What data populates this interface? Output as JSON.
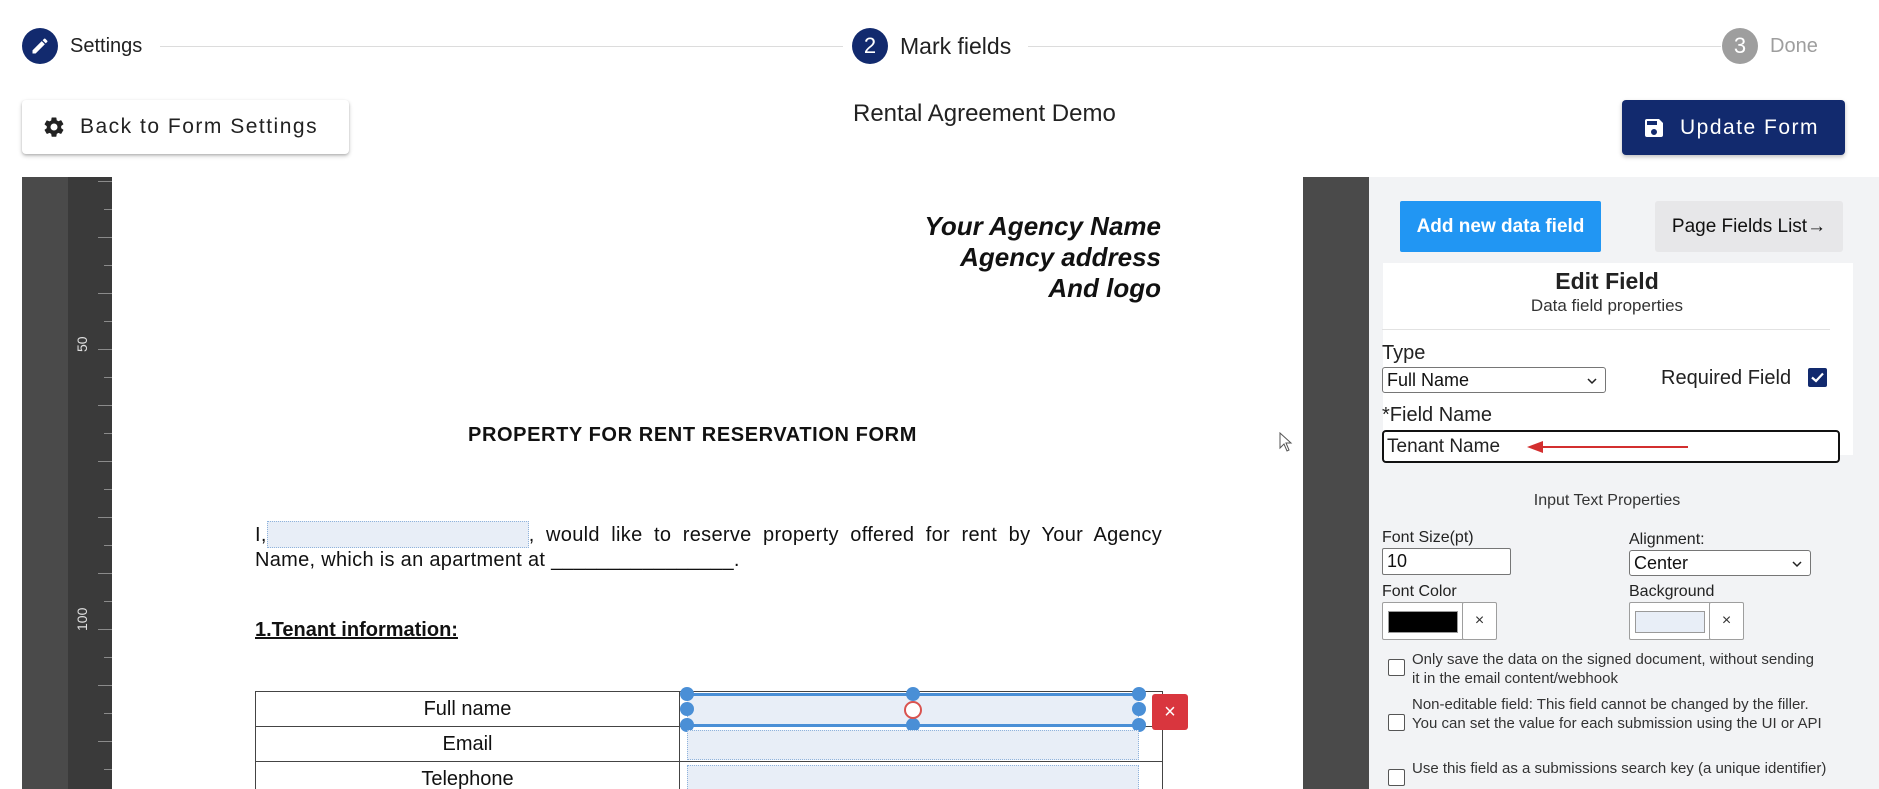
{
  "stepper": {
    "steps": [
      {
        "number": "",
        "label": "Settings",
        "state": "complete"
      },
      {
        "number": "2",
        "label": "Mark fields",
        "state": "active"
      },
      {
        "number": "3",
        "label": "Done",
        "state": "pending"
      }
    ]
  },
  "toolbar": {
    "back_label": "Back to Form Settings",
    "form_title": "Rental Agreement Demo",
    "update_label": "Update Form"
  },
  "ruler": {
    "marks": [
      "50",
      "100"
    ]
  },
  "document": {
    "agency_lines": [
      "Your Agency Name",
      "Agency address",
      "And logo"
    ],
    "title": "PROPERTY FOR RENT RESERVATION FORM",
    "para_prefix": "I,",
    "para_suffix": ", would like to reserve property offered for rent by Your Agency Name, which is an apartment at ________________.",
    "section_heading": "1.Tenant information:",
    "table_rows": [
      "Full name",
      "Email",
      "Telephone"
    ],
    "delete_glyph": "×"
  },
  "panel": {
    "add_field_label": "Add new data field",
    "fields_list_label": "Page Fields List",
    "fields_list_arrow": "→",
    "edit_title": "Edit Field",
    "edit_subtitle": "Data field properties",
    "type_label": "Type",
    "type_value": "Full Name",
    "required_label": "Required Field",
    "required_checked": true,
    "field_name_label": "*Field Name",
    "field_name_value": "Tenant Name",
    "input_props_title": "Input Text Properties",
    "font_size_label": "Font Size(pt)",
    "font_size_value": "10",
    "alignment_label": "Alignment:",
    "alignment_value": "Center",
    "font_color_label": "Font Color",
    "font_color_value": "#000000",
    "background_label": "Background",
    "background_value": "#e8eef7",
    "clear_glyph": "×",
    "options": [
      "Only save the data on the signed document, without sending it in the email content/webhook",
      "Non-editable field: This field cannot be changed by the filler. You can set the value for each submission using the UI or API",
      "Use this field as a submissions search key (a unique identifier)"
    ]
  },
  "colors": {
    "primary": "#122a6e",
    "accent": "#2196f3",
    "danger": "#d9363e",
    "selection": "#4a8fd6"
  }
}
